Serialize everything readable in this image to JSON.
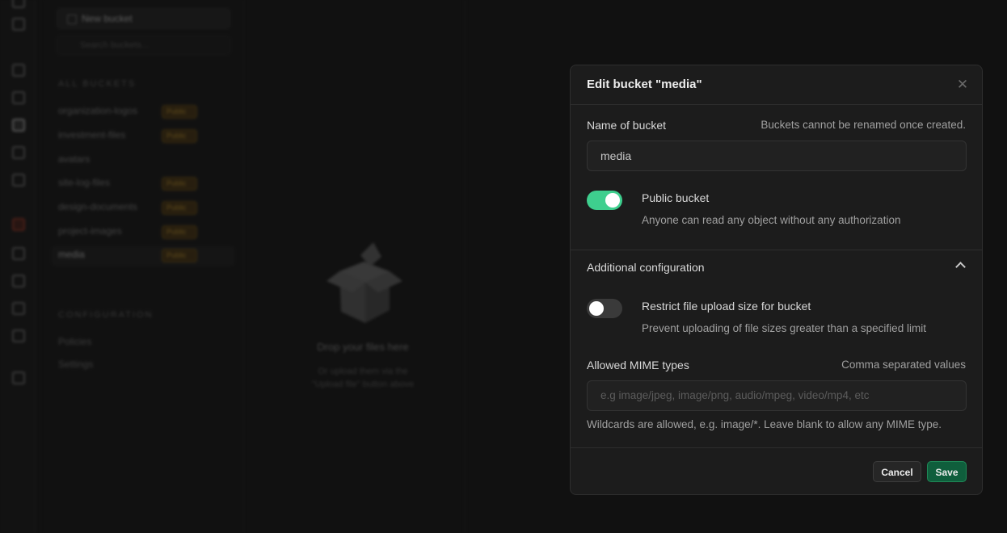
{
  "background": {
    "new_bucket_label": "New bucket",
    "search_placeholder": "Search buckets...",
    "all_buckets_heading": "ALL BUCKETS",
    "buckets": [
      {
        "name": "organization-logos",
        "badge": "Public"
      },
      {
        "name": "investment-files",
        "badge": "Public"
      },
      {
        "name": "avatars",
        "badge": ""
      },
      {
        "name": "site-log-files",
        "badge": "Public"
      },
      {
        "name": "design-documents",
        "badge": "Public"
      },
      {
        "name": "project-images",
        "badge": "Public"
      },
      {
        "name": "media",
        "badge": "Public"
      }
    ],
    "configuration_heading": "CONFIGURATION",
    "config_items": [
      "Policies",
      "Settings"
    ],
    "drop_title": "Drop your files here",
    "drop_sub_1": "Or upload them via the",
    "drop_sub_2": "\"Upload file\" button above"
  },
  "dialog": {
    "title": "Edit bucket \"media\"",
    "close_icon": "close-icon",
    "name_label": "Name of bucket",
    "name_hint": "Buckets cannot be renamed once created.",
    "name_value": "media",
    "public_label": "Public bucket",
    "public_desc": "Anyone can read any object without any authorization",
    "public_enabled": true,
    "additional_label": "Additional configuration",
    "additional_icon": "chevron-up-icon",
    "restrict_label": "Restrict file upload size for bucket",
    "restrict_desc": "Prevent uploading of file sizes greater than a specified limit",
    "restrict_enabled": false,
    "mime_label": "Allowed MIME types",
    "mime_hint": "Comma separated values",
    "mime_placeholder": "e.g image/jpeg, image/png, audio/mpeg, video/mp4, etc",
    "mime_help": "Wildcards are allowed, e.g. image/*. Leave blank to allow any MIME type.",
    "cancel_label": "Cancel",
    "save_label": "Save"
  },
  "colors": {
    "accent_green": "#3ecf8e",
    "save_bg": "#0f5e3c",
    "public_badge": "#a07a22"
  }
}
